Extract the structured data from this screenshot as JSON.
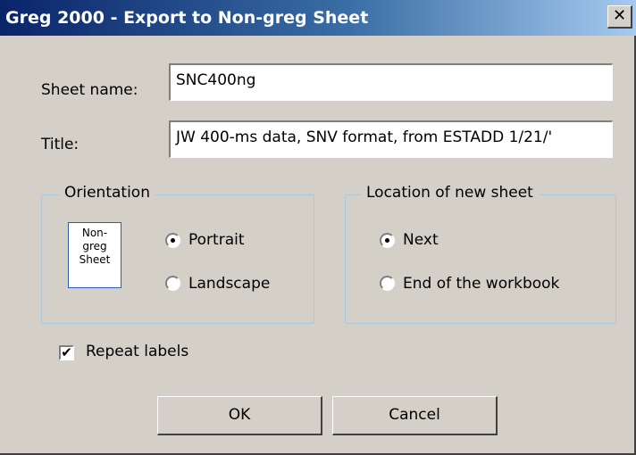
{
  "window": {
    "title": "Greg 2000 - Export to Non-greg Sheet",
    "close_glyph": "✕"
  },
  "form": {
    "sheet_name_label": "Sheet name:",
    "sheet_name_value": "SNC400ng",
    "title_label": "Title:",
    "title_value": "JW 400-ms data, SNV format, from ESTADD 1/21/'"
  },
  "orientation": {
    "legend": "Orientation",
    "preview_lines": [
      "Non-",
      "greg",
      "Sheet"
    ],
    "options": [
      {
        "label": "Portrait",
        "selected": true
      },
      {
        "label": "Landscape",
        "selected": false
      }
    ]
  },
  "location": {
    "legend": "Location of new sheet",
    "options": [
      {
        "label": "Next",
        "selected": true
      },
      {
        "label": "End of the workbook",
        "selected": false
      }
    ]
  },
  "repeat_labels": {
    "label": "Repeat labels",
    "checked": true
  },
  "buttons": {
    "ok": "OK",
    "cancel": "Cancel"
  }
}
